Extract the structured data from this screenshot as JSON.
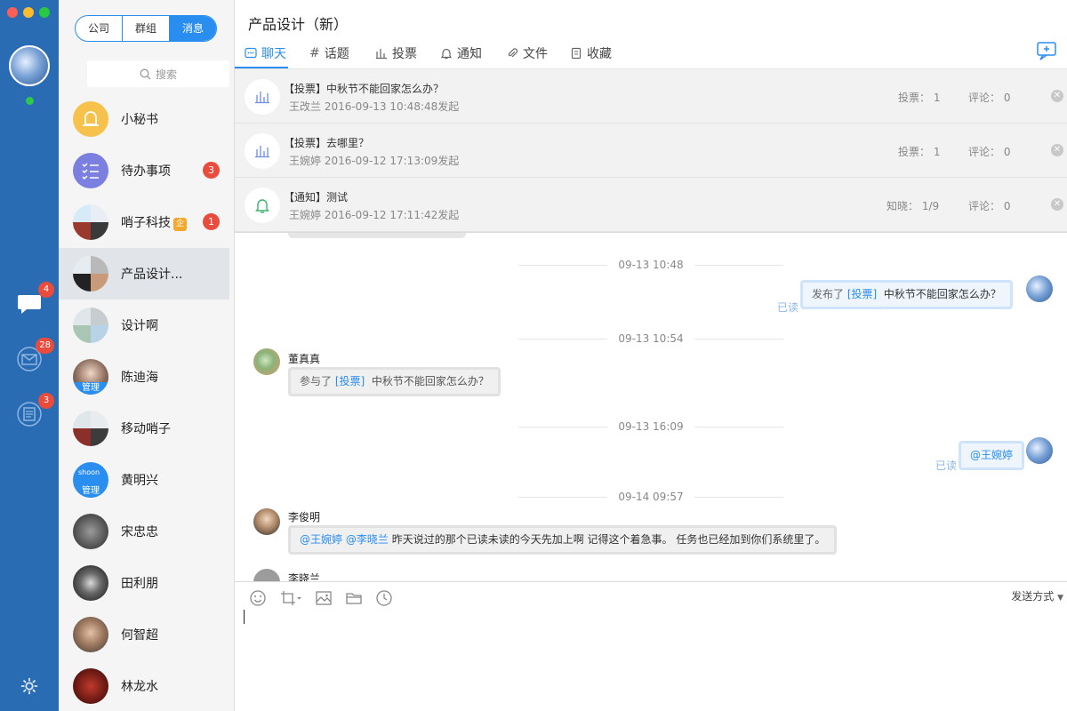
{
  "rail": {
    "badges": {
      "chat": "4",
      "mail": "28",
      "notes": "3"
    }
  },
  "segments": [
    "公司",
    "群组",
    "消息"
  ],
  "search": {
    "placeholder": "搜索"
  },
  "contacts": [
    {
      "name": "小秘书",
      "badge": ""
    },
    {
      "name": "待办事项",
      "badge": "3"
    },
    {
      "name": "哨子科技",
      "badge": "1",
      "tag_icon": "企"
    },
    {
      "name": "产品设计...",
      "badge": ""
    },
    {
      "name": "设计啊",
      "badge": ""
    },
    {
      "name": "陈迪海",
      "badge": "",
      "tag": "管理"
    },
    {
      "name": "移动哨子",
      "badge": ""
    },
    {
      "name": "黄明兴",
      "badge": "",
      "tag": "管理",
      "logo_text": "shoon"
    },
    {
      "name": "宋忠忠",
      "badge": ""
    },
    {
      "name": "田利朋",
      "badge": ""
    },
    {
      "name": "何智超",
      "badge": ""
    },
    {
      "name": "林龙水",
      "badge": ""
    }
  ],
  "main": {
    "title": "产品设计（新）",
    "tabs": [
      "聊天",
      "话题",
      "投票",
      "通知",
      "文件",
      "收藏"
    ],
    "notices": [
      {
        "title": "【投票】中秋节不能回家怎么办？",
        "sub": "王改兰 2016-09-13 10:48:48发起",
        "stat1": "投票： 1",
        "stat2": "评论： 0"
      },
      {
        "title": "【投票】去哪里？",
        "sub": "王婉婷 2016-09-12 17:13:09发起",
        "stat1": "投票： 1",
        "stat2": "评论： 0"
      },
      {
        "title": "【通知】测试",
        "sub": "王婉婷 2016-09-12 17:11:42发起",
        "stat1": "知晓： 1/9",
        "stat2": "评论： 0"
      }
    ],
    "chat": {
      "times": [
        "09-13 10:48",
        "09-13 10:54",
        "09-13 16:09",
        "09-14 09:57"
      ],
      "read_label": "已读",
      "msg1": {
        "prefix": "发布了",
        "link": "[投票]",
        "text": "中秋节不能回家怎么办？"
      },
      "msg2": {
        "sender": "董真真",
        "prefix": "参与了",
        "link": "[投票]",
        "text": "中秋节不能回家怎么办？"
      },
      "msg3": {
        "link": "@王婉婷"
      },
      "msg4": {
        "sender": "李俊明",
        "mention1": "@王婉婷",
        "mention2": "@李晓兰",
        "text": "昨天说过的那个已读未读的今天先加上啊   记得这个着急事。  任务也已经加到你们系统里了。"
      },
      "msg5": {
        "sender": "李晓兰"
      }
    },
    "composer": {
      "send_mode": "发送方式"
    }
  },
  "colors": {
    "rail": "#2a6cb4",
    "accent": "#2a8df0",
    "badge": "#e94c3c"
  }
}
